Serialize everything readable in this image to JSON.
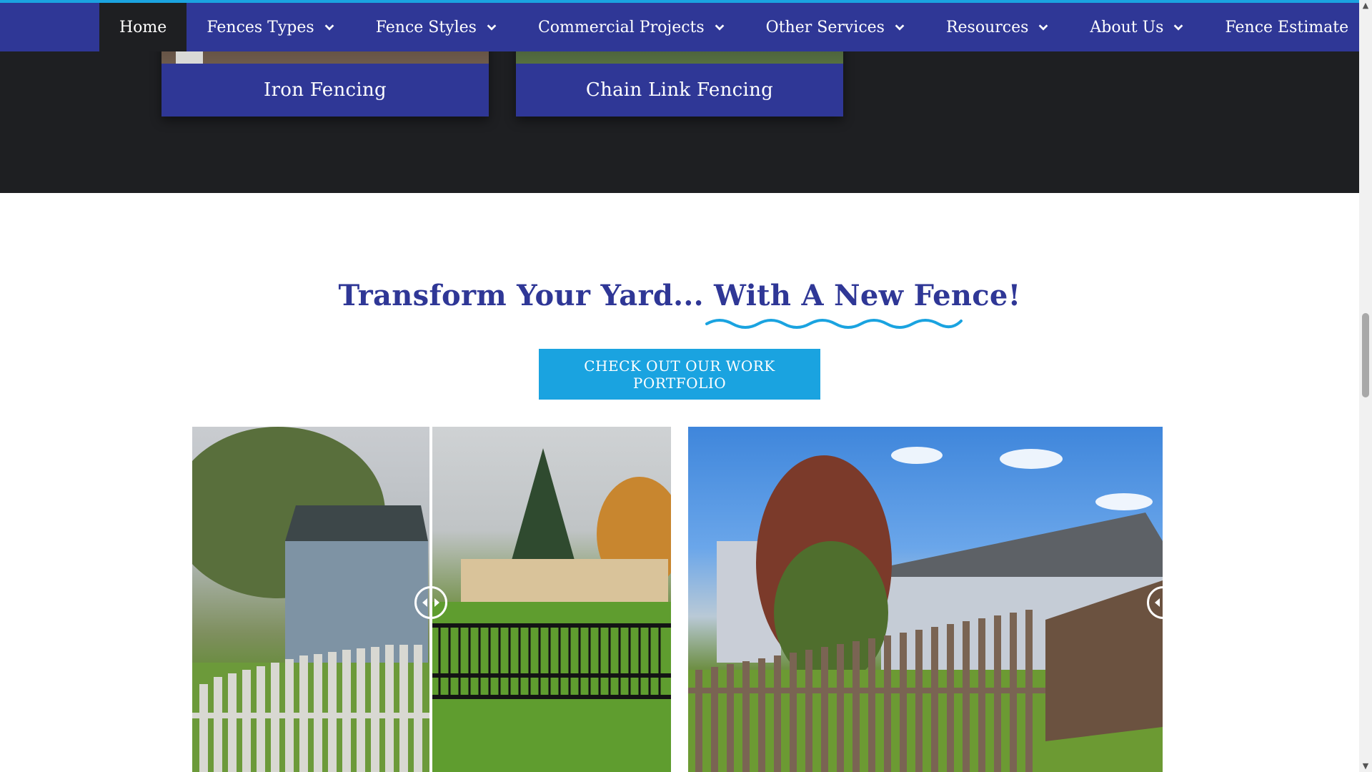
{
  "nav": {
    "items": [
      {
        "label": "Home",
        "active": true,
        "dropdown": false
      },
      {
        "label": "Fences Types",
        "active": false,
        "dropdown": true
      },
      {
        "label": "Fence Styles",
        "active": false,
        "dropdown": true
      },
      {
        "label": "Commercial Projects",
        "active": false,
        "dropdown": true
      },
      {
        "label": "Other Services",
        "active": false,
        "dropdown": true
      },
      {
        "label": "Resources",
        "active": false,
        "dropdown": true
      },
      {
        "label": "About Us",
        "active": false,
        "dropdown": true
      },
      {
        "label": "Fence Estimate",
        "active": false,
        "dropdown": false
      }
    ]
  },
  "cards": [
    {
      "label": "Iron Fencing"
    },
    {
      "label": "Chain Link Fencing"
    }
  ],
  "headline": {
    "part1": "Transform Your Yard...",
    "part2": "With A New Fence!"
  },
  "cta": {
    "label": "CHECK OUT OUR WORK PORTFOLIO"
  },
  "colors": {
    "brand_blue": "#2f3796",
    "accent_cyan": "#1aa3e0",
    "dark_bg": "#1e1f22"
  },
  "icons": {
    "nav_dropdown": "chevron-down-icon",
    "slider_handle": "compare-arrows-icon"
  }
}
